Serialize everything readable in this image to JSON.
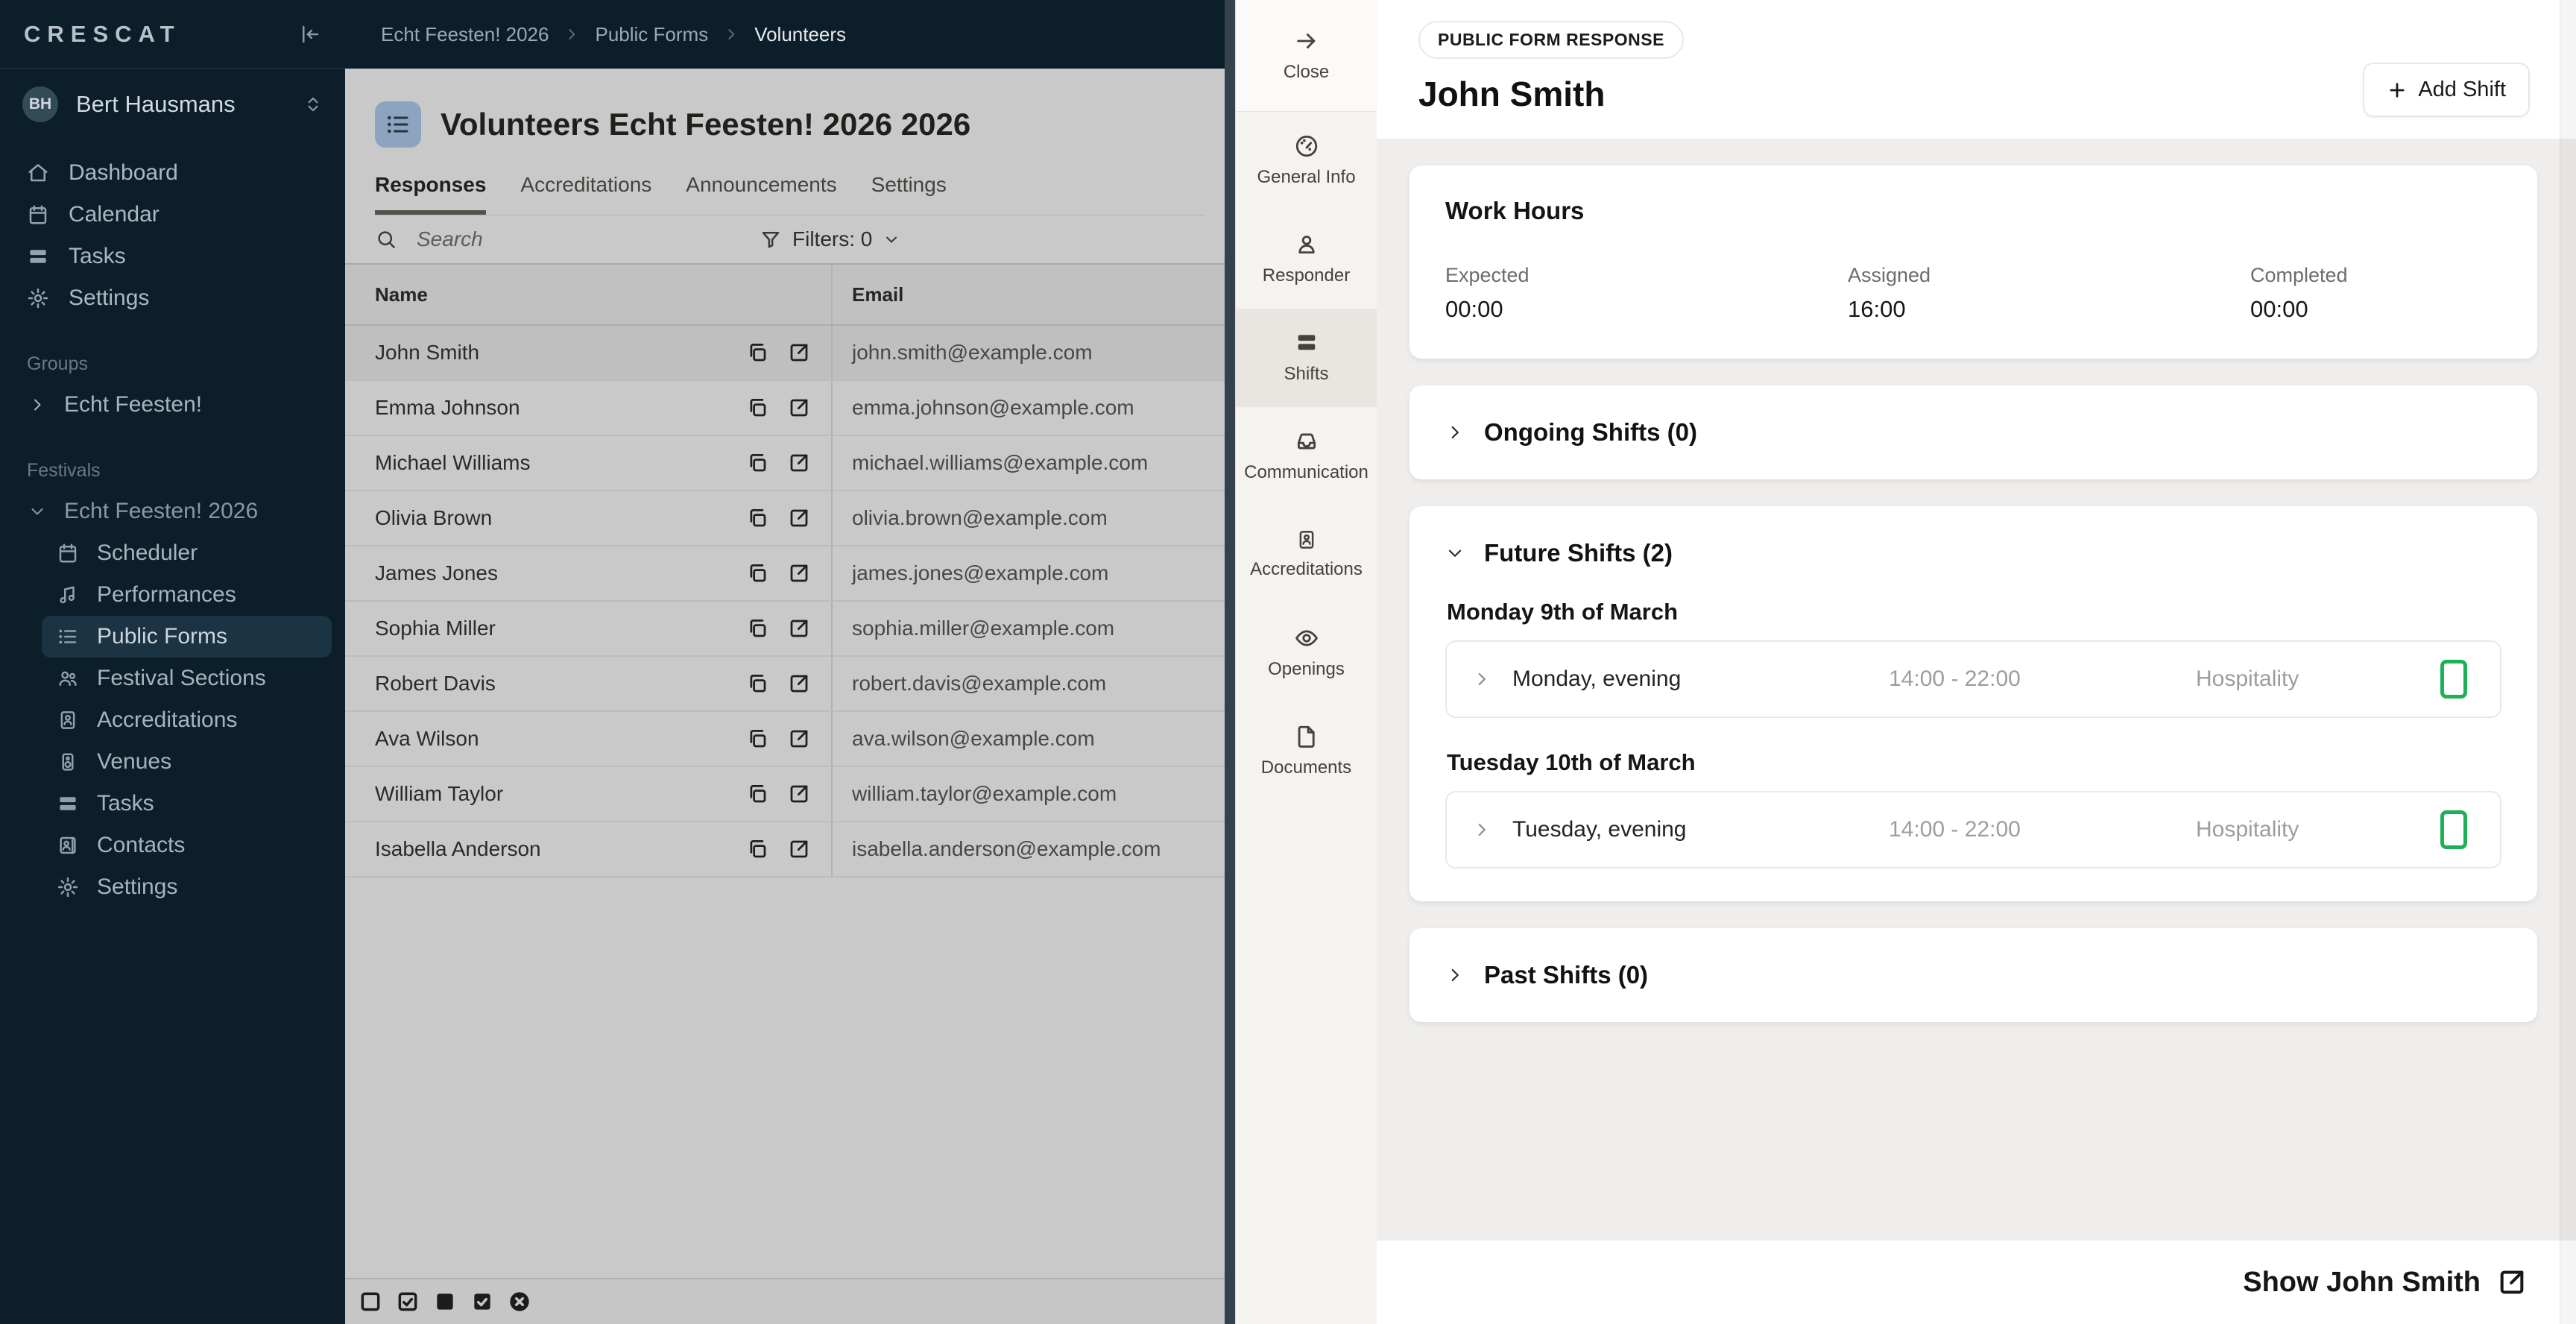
{
  "sidebar": {
    "logo": "CRESCAT",
    "user": {
      "initials": "BH",
      "name": "Bert Hausmans"
    },
    "nav": [
      {
        "label": "Dashboard",
        "icon": "home"
      },
      {
        "label": "Calendar",
        "icon": "calendar"
      },
      {
        "label": "Tasks",
        "icon": "tasks"
      },
      {
        "label": "Settings",
        "icon": "gear"
      }
    ],
    "groups_label": "Groups",
    "groups": [
      {
        "label": "Echt Feesten!"
      }
    ],
    "festivals_label": "Festivals",
    "festival": {
      "label": "Echt Feesten! 2026",
      "items": [
        {
          "label": "Scheduler",
          "icon": "calendar",
          "active": false
        },
        {
          "label": "Performances",
          "icon": "music",
          "active": false
        },
        {
          "label": "Public Forms",
          "icon": "list",
          "active": true
        },
        {
          "label": "Festival Sections",
          "icon": "people",
          "active": false
        },
        {
          "label": "Accreditations",
          "icon": "idcard",
          "active": false
        },
        {
          "label": "Venues",
          "icon": "speaker",
          "active": false
        },
        {
          "label": "Tasks",
          "icon": "tasks",
          "active": false
        },
        {
          "label": "Contacts",
          "icon": "contact",
          "active": false
        },
        {
          "label": "Settings",
          "icon": "gear",
          "active": false
        }
      ]
    }
  },
  "breadcrumb": [
    "Echt Feesten! 2026",
    "Public Forms",
    "Volunteers"
  ],
  "list_panel": {
    "title": "Volunteers Echt Feesten! 2026 2026",
    "tabs": [
      {
        "label": "Responses",
        "active": true
      },
      {
        "label": "Accreditations",
        "active": false
      },
      {
        "label": "Announcements",
        "active": false
      },
      {
        "label": "Settings",
        "active": false
      }
    ],
    "search_placeholder": "Search",
    "filters_label": "Filters: 0",
    "table": {
      "columns": [
        "Name",
        "Email"
      ],
      "rows": [
        {
          "name": "John Smith",
          "email": "john.smith@example.com",
          "selected": true
        },
        {
          "name": "Emma Johnson",
          "email": "emma.johnson@example.com",
          "selected": false
        },
        {
          "name": "Michael Williams",
          "email": "michael.williams@example.com",
          "selected": false
        },
        {
          "name": "Olivia Brown",
          "email": "olivia.brown@example.com",
          "selected": false
        },
        {
          "name": "James Jones",
          "email": "james.jones@example.com",
          "selected": false
        },
        {
          "name": "Sophia Miller",
          "email": "sophia.miller@example.com",
          "selected": false
        },
        {
          "name": "Robert Davis",
          "email": "robert.davis@example.com",
          "selected": false
        },
        {
          "name": "Ava Wilson",
          "email": "ava.wilson@example.com",
          "selected": false
        },
        {
          "name": "William Taylor",
          "email": "william.taylor@example.com",
          "selected": false
        },
        {
          "name": "Isabella Anderson",
          "email": "isabella.anderson@example.com",
          "selected": false
        }
      ]
    },
    "footer_icons": [
      "square-outline",
      "square-check-outline",
      "square-filled",
      "square-check-filled",
      "circle-x-filled"
    ]
  },
  "detail_nav": [
    {
      "label": "Close",
      "icon": "arrow-right",
      "active": false,
      "kind": "close"
    },
    {
      "label": "General Info",
      "icon": "gauge",
      "active": false,
      "kind": "item"
    },
    {
      "label": "Responder",
      "icon": "person",
      "active": false,
      "kind": "item"
    },
    {
      "label": "Shifts",
      "icon": "shifts",
      "active": true,
      "kind": "item"
    },
    {
      "label": "Communication",
      "icon": "inbox",
      "active": false,
      "kind": "item"
    },
    {
      "label": "Accreditations",
      "icon": "idcard",
      "active": false,
      "kind": "item"
    },
    {
      "label": "Openings",
      "icon": "eye",
      "active": false,
      "kind": "item"
    },
    {
      "label": "Documents",
      "icon": "file",
      "active": false,
      "kind": "item"
    }
  ],
  "detail": {
    "badge": "PUBLIC FORM RESPONSE",
    "title": "John Smith",
    "add_shift_label": "Add Shift",
    "work_hours": {
      "title": "Work Hours",
      "stats": [
        {
          "label": "Expected",
          "value": "00:00"
        },
        {
          "label": "Assigned",
          "value": "16:00"
        },
        {
          "label": "Completed",
          "value": "00:00"
        }
      ]
    },
    "sections": {
      "ongoing": "Ongoing Shifts (0)",
      "future": "Future Shifts (2)",
      "past": "Past Shifts (0)"
    },
    "shift_groups": [
      {
        "date": "Monday 9th of March",
        "shifts": [
          {
            "name": "Monday, evening",
            "time": "14:00 - 22:00",
            "section": "Hospitality"
          }
        ]
      },
      {
        "date": "Tuesday 10th of March",
        "shifts": [
          {
            "name": "Tuesday, evening",
            "time": "14:00 - 22:00",
            "section": "Hospitality"
          }
        ]
      }
    ],
    "footer_link": "Show John Smith"
  },
  "colors": {
    "sidebar_bg": "#0c1e2a",
    "dim_panel_bg": "#c9c9c9",
    "nav_strip_bg": "#f5f3f0",
    "detail_body_bg": "#efeeec",
    "accent_green": "#1db056",
    "title_icon_bg": "#8ca4bf"
  }
}
